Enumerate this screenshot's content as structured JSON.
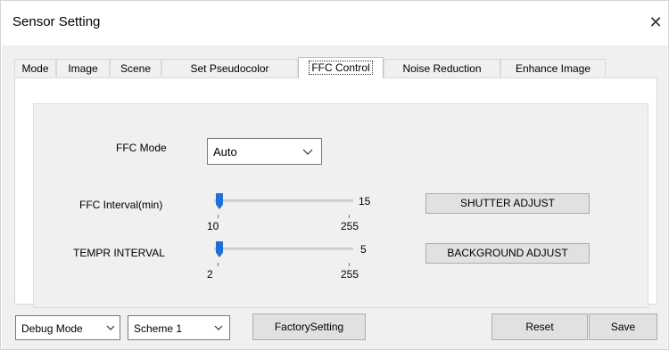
{
  "window": {
    "title": "Sensor Setting",
    "close_glyph": "✕"
  },
  "tabs": [
    {
      "label": "Mode",
      "active": false
    },
    {
      "label": "Image",
      "active": false
    },
    {
      "label": "Scene",
      "active": false
    },
    {
      "label": "Set Pseudocolor",
      "active": false
    },
    {
      "label": "FFC Control",
      "active": true
    },
    {
      "label": "Noise Reduction",
      "active": false
    },
    {
      "label": "Enhance Image",
      "active": false
    }
  ],
  "ffc": {
    "mode_label": "FFC Mode",
    "mode_value": "Auto",
    "interval": {
      "label": "FFC Interval(min)",
      "value": "15",
      "min": "10",
      "max": "255"
    },
    "tempr": {
      "label": "TEMPR INTERVAL",
      "value": "5",
      "min": "2",
      "max": "255"
    },
    "shutter_adjust": "SHUTTER ADJUST",
    "background_adjust": "BACKGROUND ADJUST"
  },
  "footer": {
    "debug_mode": "Debug Mode",
    "scheme": "Scheme 1",
    "factory_setting": "FactorySetting",
    "reset": "Reset",
    "save": "Save"
  }
}
